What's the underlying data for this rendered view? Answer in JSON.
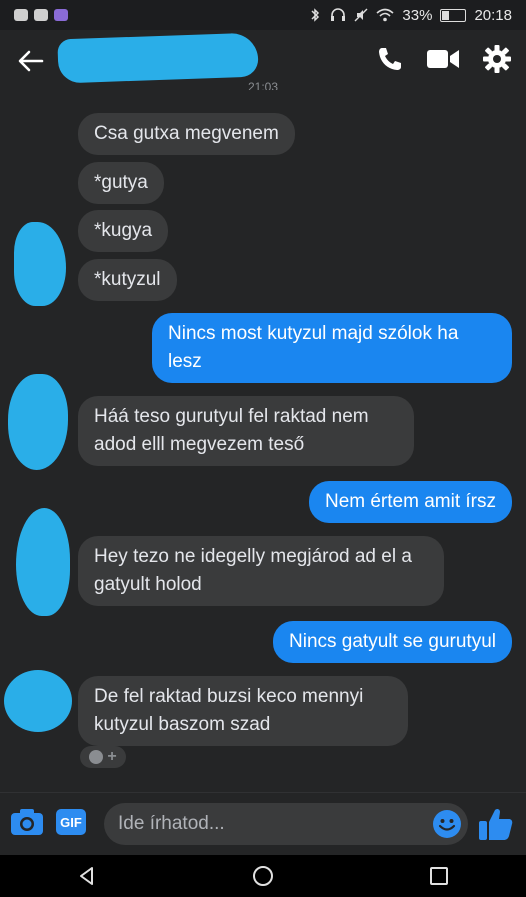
{
  "status": {
    "battery": "33%",
    "time": "20:18"
  },
  "header": {
    "contact_name": "",
    "timestamp": "21:03"
  },
  "messages": [
    {
      "dir": "in",
      "text": "Csa gutxa megvenem"
    },
    {
      "dir": "in",
      "text": "*gutya"
    },
    {
      "dir": "in",
      "text": "*kugya"
    },
    {
      "dir": "in",
      "text": "*kutyzul"
    },
    {
      "dir": "out",
      "text": "Nincs most kutyzul majd szólok ha lesz"
    },
    {
      "dir": "in",
      "text": "Háá teso gurutyul fel raktad nem adod elll megvezem teső"
    },
    {
      "dir": "out",
      "text": "Nem értem amit írsz"
    },
    {
      "dir": "in",
      "text": "Hey tezo ne idegelly megjárod ad el a gatyult holod"
    },
    {
      "dir": "out",
      "text": "Nincs gatyult se gurutyul"
    },
    {
      "dir": "in",
      "text": "De fel raktad buzsi keco mennyi kutyzul baszom szad"
    }
  ],
  "composer": {
    "gif_label": "GIF",
    "placeholder": "Ide írhatod..."
  },
  "colors": {
    "background": "#242526",
    "incoming_bubble": "#3a3b3c",
    "outgoing_bubble": "#1a86f0",
    "accent": "#2d8cf0"
  },
  "icons": [
    "back-arrow-icon",
    "phone-icon",
    "video-camera-icon",
    "gear-icon",
    "camera-icon",
    "emoji-icon",
    "thumbs-up-icon"
  ]
}
